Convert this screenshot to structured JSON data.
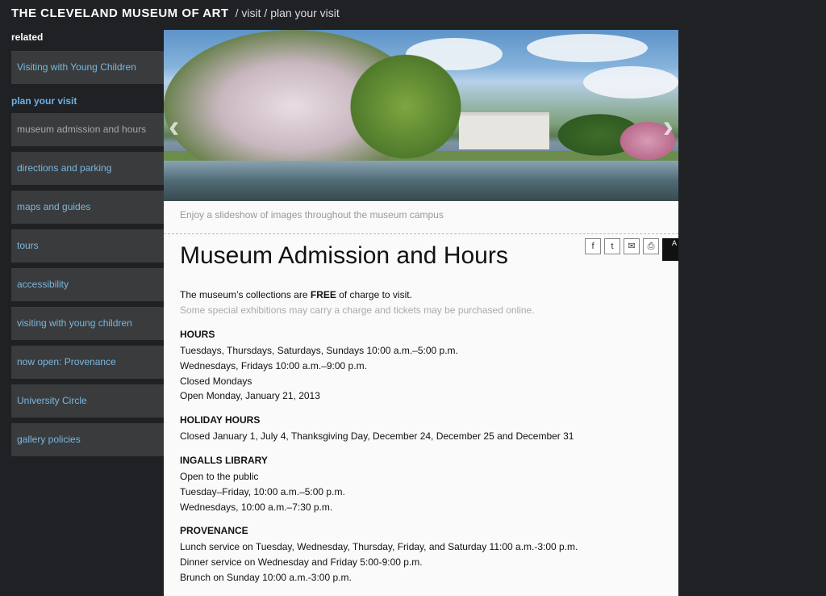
{
  "header": {
    "brand": "THE CLEVELAND MUSEUM OF ART",
    "crumb_sep1": "/",
    "crumb1": "visit",
    "crumb_sep2": "/",
    "crumb2": "plan your visit"
  },
  "sidebar": {
    "related_heading": "related",
    "related_items": [
      "Visiting with Young Children"
    ],
    "plan_heading": "plan your visit",
    "plan_items": [
      "museum admission and hours",
      "directions and parking",
      "maps and guides",
      "tours",
      "accessibility",
      "visiting with young children",
      "now open: Provenance",
      "University Circle",
      "gallery policies"
    ]
  },
  "hero": {
    "prev_icon": "chevron-left-icon",
    "next_icon": "chevron-right-icon",
    "caption": "Enjoy a slideshow of images throughout the museum campus"
  },
  "share": {
    "facebook": "f",
    "twitter": "t",
    "email": "✉",
    "print": "⎙",
    "text_size": "A"
  },
  "page": {
    "title": "Museum Admission and Hours",
    "intro_pre": "The museum’s collections are ",
    "intro_bold": "FREE",
    "intro_post": " of charge to visit.",
    "intro_note": "Some special exhibitions may carry a charge and tickets may be purchased online.",
    "sections": [
      {
        "heading": "HOURS",
        "lines": [
          "Tuesdays, Thursdays, Saturdays, Sundays 10:00 a.m.–5:00 p.m.",
          "Wednesdays, Fridays 10:00 a.m.–9:00 p.m.",
          "Closed Mondays",
          "Open Monday, January 21, 2013"
        ]
      },
      {
        "heading": "HOLIDAY HOURS",
        "lines": [
          "Closed January 1, July 4, Thanksgiving Day, December 24, December 25 and December 31"
        ]
      },
      {
        "heading": "INGALLS LIBRARY",
        "lines": [
          "Open to the public",
          "Tuesday–Friday, 10:00 a.m.–5:00 p.m.",
          "Wednesdays, 10:00 a.m.–7:30 p.m."
        ]
      },
      {
        "heading": "PROVENANCE",
        "lines": [
          "Lunch service on Tuesday, Wednesday, Thursday, Friday, and Saturday 11:00 a.m.-3:00 p.m.",
          "Dinner service on Wednesday and Friday 5:00-9:00 p.m.",
          "Brunch on Sunday 10:00 a.m.-3:00 p.m."
        ]
      }
    ]
  }
}
